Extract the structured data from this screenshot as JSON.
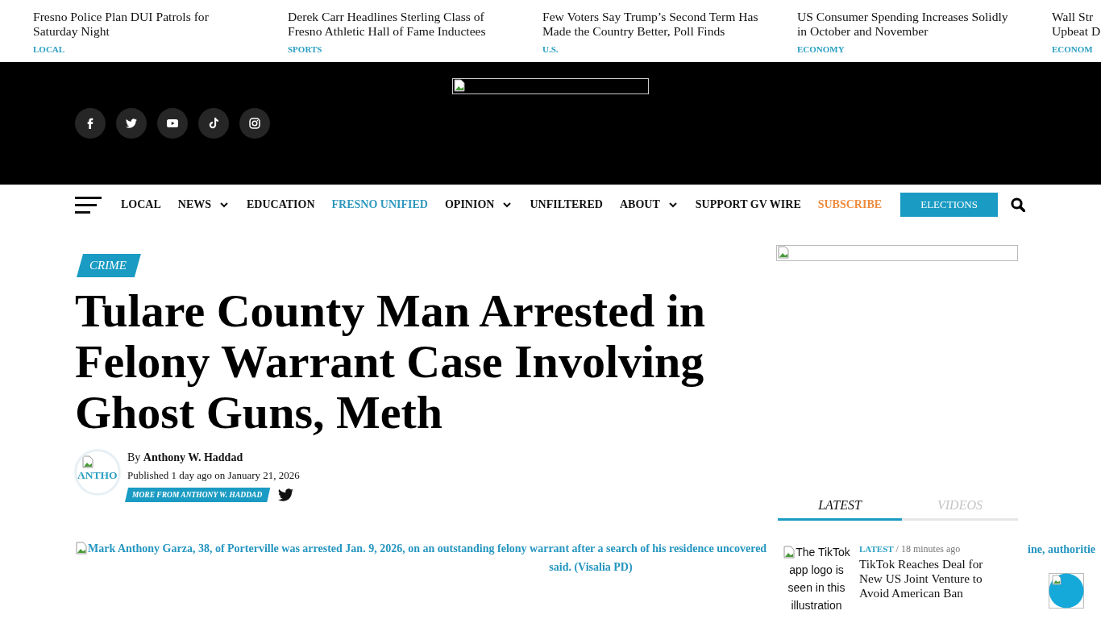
{
  "ticker": [
    {
      "lines": [
        "Fresno Police Plan DUI Patrols for",
        "Saturday Night"
      ],
      "category": "LOCAL"
    },
    {
      "lines": [
        "Derek Carr Headlines Sterling Class of",
        "Fresno Athletic Hall of Fame Inductees"
      ],
      "category": "SPORTS"
    },
    {
      "lines": [
        "Few Voters Say Trump’s Second Term Has",
        "Made the Country Better, Poll Finds"
      ],
      "category": "U.S."
    },
    {
      "lines": [
        "US Consumer Spending Increases Solidly",
        "in October and November"
      ],
      "category": "ECONOMY"
    },
    {
      "lines": [
        "Wall Str",
        "Upbeat D"
      ],
      "category": "ECONOM"
    }
  ],
  "nav": {
    "items": [
      {
        "label": "LOCAL",
        "kind": "link",
        "has_menu": false,
        "color": "#111111"
      },
      {
        "label": "NEWS",
        "kind": "link",
        "has_menu": true,
        "color": "#111111"
      },
      {
        "label": "EDUCATION",
        "kind": "link",
        "has_menu": false,
        "color": "#111111"
      },
      {
        "label": "FRESNO UNIFIED",
        "kind": "link",
        "has_menu": false,
        "color": "#2f98bd"
      },
      {
        "label": "OPINION",
        "kind": "link",
        "has_menu": true,
        "color": "#111111"
      },
      {
        "label": "UNFILTERED",
        "kind": "link",
        "has_menu": false,
        "color": "#111111"
      },
      {
        "label": "ABOUT",
        "kind": "link",
        "has_menu": true,
        "color": "#111111"
      },
      {
        "label": "SUPPORT GV WIRE",
        "kind": "link",
        "has_menu": false,
        "color": "#111111"
      },
      {
        "label": "SUBSCRIBE",
        "kind": "link",
        "has_menu": false,
        "color": "#ee8a3c"
      },
      {
        "label": "ELECTIONS",
        "kind": "button",
        "has_menu": false,
        "color": "#1a9bc3"
      }
    ]
  },
  "article": {
    "category": "CRIME",
    "title": "Tulare County Man Arrested in Felony Warrant Case Involving Ghost Guns, Meth",
    "author": {
      "avatar_alt": "ANTHO",
      "byline_prefix": "By",
      "name": "Anthony W. Haddad",
      "published": "Published 1 day ago on January 21, 2026",
      "more_button": "MORE FROM ANTHONY W. HADDAD"
    },
    "image_alt": {
      "first_line": "Mark Anthony Garza, 38, of Porterville was arrested Jan. 9, 2026, on an outstanding felony warrant after a search of his residence uncovered",
      "line_end": "ine, authoritie",
      "last_line": "said. (Visalia PD)"
    }
  },
  "sidebar": {
    "tabs": [
      {
        "label": "LATEST",
        "selected": true
      },
      {
        "label": "VIDEOS",
        "selected": false
      }
    ],
    "posts": [
      {
        "thumb_alt": "The TikTok app logo is seen in this illustration",
        "category": "LATEST",
        "time": "/ 18 minutes ago",
        "title": "TikTok Reaches Deal for New US Joint Venture to Avoid American Ban"
      }
    ]
  }
}
